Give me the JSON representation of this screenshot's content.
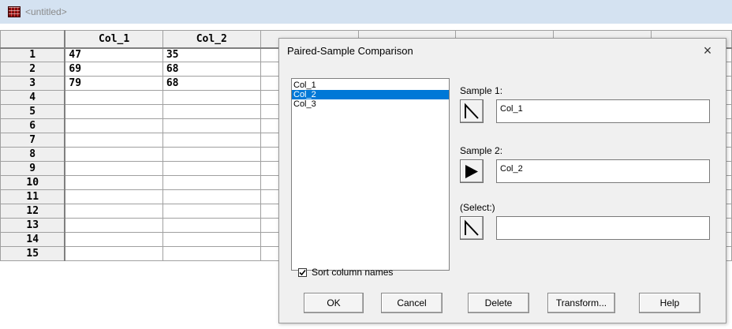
{
  "window": {
    "title": "<untitled>"
  },
  "sheet": {
    "columns": [
      "Col_1",
      "Col_2"
    ],
    "row_numbers": [
      "1",
      "2",
      "3",
      "4",
      "5",
      "6",
      "7",
      "8",
      "9",
      "10",
      "11",
      "12",
      "13",
      "14",
      "15"
    ],
    "cells": [
      [
        "47",
        "35"
      ],
      [
        "69",
        "68"
      ],
      [
        "79",
        "68"
      ]
    ]
  },
  "dialog": {
    "title": "Paired-Sample Comparison",
    "list_items": [
      "Col_1",
      "Col_2",
      "Col_3"
    ],
    "selected_item": "Col_2",
    "sample1_label": "Sample 1:",
    "sample1_value": "Col_1",
    "sample2_label": "Sample 2:",
    "sample2_value": "Col_2",
    "select_label": "(Select:)",
    "select_value": "",
    "sort_label": "Sort column names",
    "sort_checked": true,
    "buttons": {
      "ok": "OK",
      "cancel": "Cancel",
      "delete": "Delete",
      "transform": "Transform...",
      "help": "Help"
    },
    "close_glyph": "×"
  },
  "colors": {
    "titlebar": "#d4e2f1",
    "selection": "#0078d7",
    "dialog_bg": "#f0f0f0"
  },
  "icons": [
    "grid-icon",
    "close-icon",
    "arrow-hollow-icon",
    "arrow-solid-icon",
    "checkmark-icon"
  ]
}
